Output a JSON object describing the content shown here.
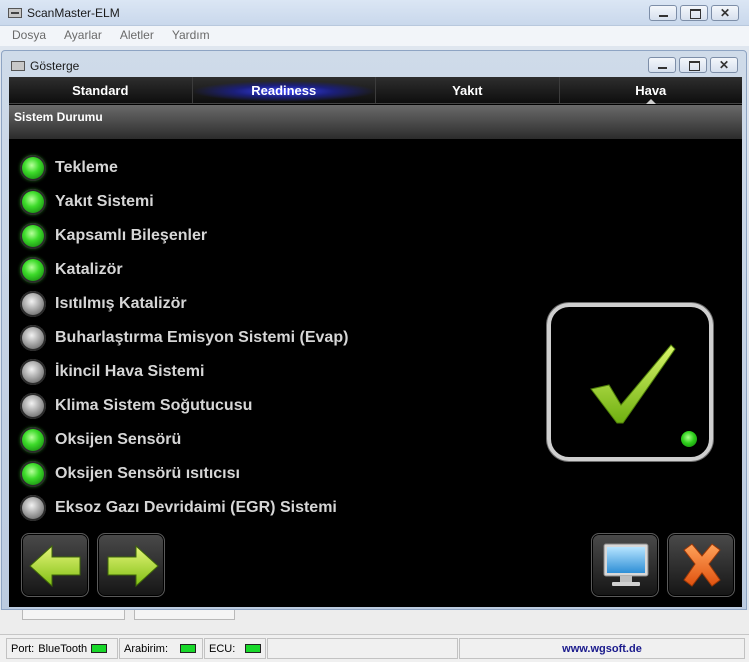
{
  "app": {
    "title": "ScanMaster-ELM"
  },
  "menu": [
    "Dosya",
    "Ayarlar",
    "Aletler",
    "Yardım"
  ],
  "child_window": {
    "title": "Gösterge"
  },
  "tabs": [
    {
      "label": "Standard",
      "active": false
    },
    {
      "label": "Readiness",
      "active": true
    },
    {
      "label": "Yakıt",
      "active": false
    },
    {
      "label": "Hava",
      "active": false
    }
  ],
  "section_header": "Sistem Durumu",
  "status_items": [
    {
      "label": "Tekleme",
      "status": "on"
    },
    {
      "label": "Yakıt Sistemi",
      "status": "on"
    },
    {
      "label": "Kapsamlı Bileşenler",
      "status": "on"
    },
    {
      "label": "Katalizör",
      "status": "on"
    },
    {
      "label": "Isıtılmış Katalizör",
      "status": "off"
    },
    {
      "label": "Buharlaştırma Emisyon Sistemi (Evap)",
      "status": "off"
    },
    {
      "label": "İkincil Hava Sistemi",
      "status": "off"
    },
    {
      "label": "Klima Sistem Soğutucusu",
      "status": "off"
    },
    {
      "label": "Oksijen Sensörü",
      "status": "on"
    },
    {
      "label": "Oksijen Sensörü ısıtıcısı",
      "status": "on"
    },
    {
      "label": "Eksoz Gazı Devridaimi (EGR) Sistemi",
      "status": "off"
    }
  ],
  "overall_status": {
    "icon": "checkmark-icon",
    "indicator": "on"
  },
  "buttons": {
    "back": "arrow-left-icon",
    "forward": "arrow-right-icon",
    "monitor": "monitor-icon",
    "close": "close-x-icon"
  },
  "statusbar": {
    "port_label": "Port:",
    "port_value": "BlueTooth",
    "interface_label": "Arabirim:",
    "ecu_label": "ECU:",
    "link": "www.wgsoft.de"
  },
  "colors": {
    "led_on": "#3ddb2a",
    "led_off": "#a8a8a8",
    "checkmark": "#8fd01c",
    "active_tab_glow": "#3b45ff",
    "close_button": "#f06a1c",
    "status_indicator": "#18d82a"
  }
}
